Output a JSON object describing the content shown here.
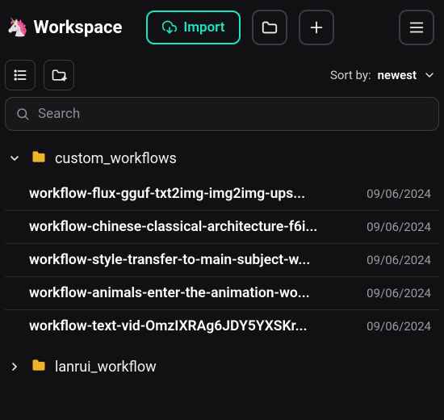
{
  "header": {
    "brand_icon": "🦄",
    "title": "Workspace",
    "import_label": "Import"
  },
  "toolbar": {
    "sort_label": "Sort by:",
    "sort_value": "newest"
  },
  "search": {
    "placeholder": "Search",
    "value": ""
  },
  "tree": {
    "folders": [
      {
        "name": "custom_workflows",
        "expanded": true,
        "files": [
          {
            "name": "workflow-flux-gguf-txt2img-img2img-ups...",
            "date": "09/06/2024"
          },
          {
            "name": "workflow-chinese-classical-architecture-f6i...",
            "date": "09/06/2024"
          },
          {
            "name": "workflow-style-transfer-to-main-subject-w...",
            "date": "09/06/2024"
          },
          {
            "name": "workflow-animals-enter-the-animation-wo...",
            "date": "09/06/2024"
          },
          {
            "name": "workflow-text-vid-OmzIXRAg6JDY5YXSKr...",
            "date": "09/06/2024"
          }
        ]
      },
      {
        "name": "lanrui_workflow",
        "expanded": false,
        "files": []
      }
    ]
  }
}
